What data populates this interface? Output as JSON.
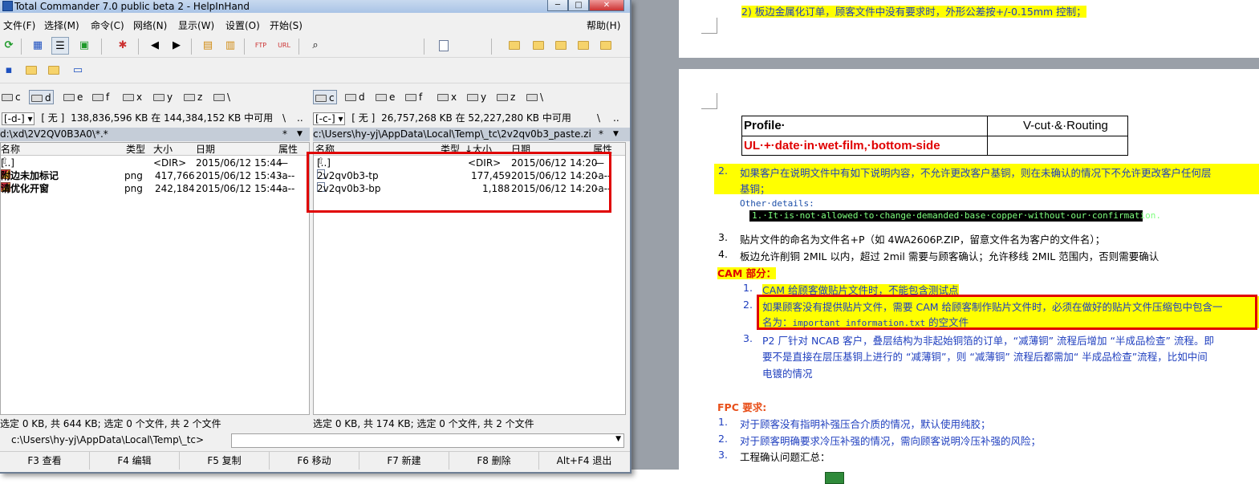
{
  "tc": {
    "title": "Total Commander 7.0 public beta 2 - HelpInHand",
    "window_buttons": {
      "minimize": "─",
      "maximize": "□",
      "close": "✕"
    },
    "menu": [
      "文件(F)",
      "选择(M)",
      "命令(C)",
      "网络(N)",
      "显示(W)",
      "设置(O)",
      "开始(S)"
    ],
    "help_menu": "帮助(H)",
    "left": {
      "drives": [
        "c",
        "d",
        "e",
        "f",
        "x",
        "y",
        "z",
        "\\"
      ],
      "selected_drive": "d",
      "drive_combo": "[-d-]",
      "volume": "[ 无 ]",
      "free_text": "138,836,596 KB 在 144,384,152 KB 中可用",
      "path_buttons": [
        "\\",
        ".."
      ],
      "path": "d:\\xd\\2V2QV0B3A0\\*.*",
      "path_star": "*",
      "path_arrow": "▼",
      "columns": {
        "name": "名称",
        "ext": "类型",
        "size": "大小",
        "date": "日期",
        "attr": "属性"
      },
      "rows": [
        {
          "name": "[..]",
          "ext": "",
          "size": "<DIR>",
          "date": "2015/06/12 15:44",
          "attr": "—"
        },
        {
          "name": "附边未加标记",
          "ext": "png",
          "size": "417,766",
          "date": "2015/06/12 15:43",
          "attr": "-a--"
        },
        {
          "name": "请优化开窗",
          "ext": "png",
          "size": "242,184",
          "date": "2015/06/12 15:44",
          "attr": "-a--"
        }
      ],
      "status": "选定 0 KB, 共 644 KB; 选定 0 个文件, 共 2 个文件"
    },
    "right": {
      "drives": [
        "c",
        "d",
        "e",
        "f",
        "x",
        "y",
        "z",
        "\\"
      ],
      "selected_drive": "c",
      "drive_combo": "[-c-]",
      "volume": "[ 无 ]",
      "free_text": "26,757,268 KB 在 52,227,280 KB 中可用",
      "path_buttons": [
        "\\",
        ".."
      ],
      "path": "c:\\Users\\hy-yj\\AppData\\Local\\Temp\\_tc\\2v2qv0b3_paste.zi",
      "path_star": "*",
      "path_arrow": "▼",
      "columns": {
        "name": "名称",
        "ext": "类型",
        "sort": "↓",
        "size": "大小",
        "date": "日期",
        "attr": "属性"
      },
      "rows": [
        {
          "name": "[..]",
          "ext": "",
          "size": "<DIR>",
          "date": "2015/06/12 14:20",
          "attr": "—"
        },
        {
          "name": "2v2qv0b3-tp",
          "ext": "",
          "size": "177,459",
          "date": "2015/06/12 14:20",
          "attr": "-a--"
        },
        {
          "name": "2v2qv0b3-bp",
          "ext": "",
          "size": "1,188",
          "date": "2015/06/12 14:20",
          "attr": "-a--"
        }
      ],
      "status": "选定 0 KB, 共 174 KB; 选定 0 个文件, 共 2 个文件"
    },
    "cmd_path": "c:\\Users\\hy-yj\\AppData\\Local\\Temp\\_tc>",
    "cmd_arrow": "▼",
    "fkeys": [
      "F3 查看",
      "F4 编辑",
      "F5 复制",
      "F6 移动",
      "F7 新建",
      "F8 删除",
      "Alt+F4 退出"
    ]
  },
  "word": {
    "line_top": "2)  板边金属化订单，顾客文件中没有要求时，外形公差按+/-0.15mm 控制；",
    "table": {
      "c1": "Profile·",
      "c2": "V-cut·&·Routing",
      "c3": "UL·+·date·in·wet-film,·bottom-side"
    },
    "item2_num": "2.",
    "item2": "如果客户在说明文件中有如下说明内容，不允许更改客户基铜，则在未确认的情况下不允许更改客户任何层",
    "item2_cont": "基铜；",
    "other_details": "Other·details:",
    "code_line": "1.·It·is·not·allowed·to·change·demanded·base·copper·without·our·confirmation.",
    "item3_num": "3.",
    "item3": "贴片文件的命名为文件名+P（如 4WA2606P.ZIP，留意文件名为客户的文件名）；",
    "item4_num": "4.",
    "item4": "板边允许削铜 2MIL 以内，超过 2mil 需要与顾客确认；允许移线 2MIL 范围内，否则需要确认",
    "cam_title": "CAM 部分：",
    "cam1_num": "1.",
    "cam1": "CAM 给顾客做贴片文件时，不能包含测试点",
    "cam2_num": "2.",
    "cam2": "如果顾客没有提供贴片文件，需要 CAM 给顾客制作贴片文件时，必须在做好的贴片文件压缩包中包含一",
    "cam2_cont_a": "名为：",
    "cam2_cont_b": "important information.txt",
    "cam2_cont_c": " 的空文件",
    "cam3_num": "3.",
    "cam3": "P2 厂针对 NCAB 客户，叠层结构为非起始铜箔的订单，“减薄铜” 流程后增加 “半成品检查” 流程。即",
    "cam3_cont": "要不是直接在层压基铜上进行的 “减薄铜”，则 “减薄铜” 流程后都需加“ 半成品检查”流程，比如中间",
    "cam3_cont2": "电镀的情况",
    "fpc_title": "FPC 要求:",
    "fpc1_num": "1.",
    "fpc1": "对于顾客没有指明补强压合介质的情况，默认使用纯胶；",
    "fpc2_num": "2.",
    "fpc2": "对于顾客明确要求冷压补强的情况，需向顾客说明冷压补强的风险；",
    "fpc3_num": "3.",
    "fpc3": "工程确认问题汇总："
  },
  "colors": {
    "highlight": "#ffff00",
    "red": "#e00000",
    "blue": "#1f3fbf",
    "orange": "#e8501b"
  }
}
